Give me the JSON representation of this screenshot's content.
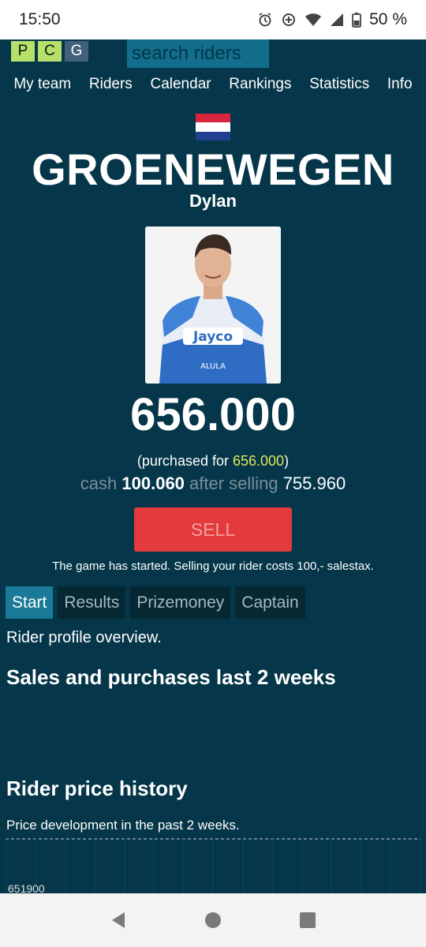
{
  "status_bar": {
    "time": "15:50",
    "battery": "50 %"
  },
  "logo": {
    "letters": [
      "P",
      "C",
      "G"
    ]
  },
  "search": {
    "placeholder": "search riders"
  },
  "nav": [
    "My team",
    "Riders",
    "Calendar",
    "Rankings",
    "Statistics",
    "Info"
  ],
  "rider": {
    "surname": "GROENEWEGEN",
    "firstname": "Dylan",
    "country_flag": "netherlands-flag"
  },
  "price": "656.000",
  "purchase": {
    "prefix": "(purchased for ",
    "amount": "656.000",
    "suffix": ")"
  },
  "cash": {
    "label": "cash",
    "amount": "100.060",
    "after_label": "after selling",
    "after_amount": "755.960"
  },
  "sell_button": "SELL",
  "notice": "The game has started. Selling your rider costs 100,- salestax.",
  "tabs": [
    "Start",
    "Results",
    "Prizemoney",
    "Captain"
  ],
  "profile_text": "Rider profile overview.",
  "sales_heading": "Sales and purchases last 2 weeks",
  "history": {
    "heading": "Rider price history",
    "text": "Price development in the past 2 weeks.",
    "axis_label": "651900"
  },
  "colors": {
    "background": "#053649",
    "sell": "#e33a3c",
    "highlight": "#e2e85a",
    "active_tab": "#1a7a98"
  }
}
